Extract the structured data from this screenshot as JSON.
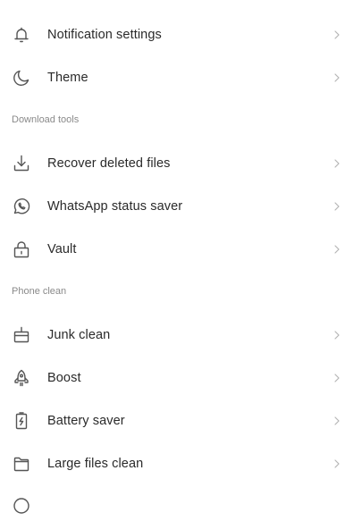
{
  "settings": {
    "general_items": [
      {
        "label": "Notification settings",
        "icon": "bell-icon"
      },
      {
        "label": "Theme",
        "icon": "moon-icon"
      }
    ],
    "sections": [
      {
        "title": "Download tools",
        "items": [
          {
            "label": "Recover deleted files",
            "icon": "download-icon"
          },
          {
            "label": "WhatsApp status saver",
            "icon": "whatsapp-icon"
          },
          {
            "label": "Vault",
            "icon": "lock-icon"
          }
        ]
      },
      {
        "title": "Phone clean",
        "items": [
          {
            "label": "Junk clean",
            "icon": "broom-icon"
          },
          {
            "label": "Boost",
            "icon": "rocket-icon"
          },
          {
            "label": "Battery saver",
            "icon": "battery-icon"
          },
          {
            "label": "Large files clean",
            "icon": "folder-icon"
          }
        ]
      }
    ]
  },
  "colors": {
    "icon_stroke": "#555555",
    "chevron": "#b5b5b5",
    "section_title": "#8a8a8a"
  }
}
